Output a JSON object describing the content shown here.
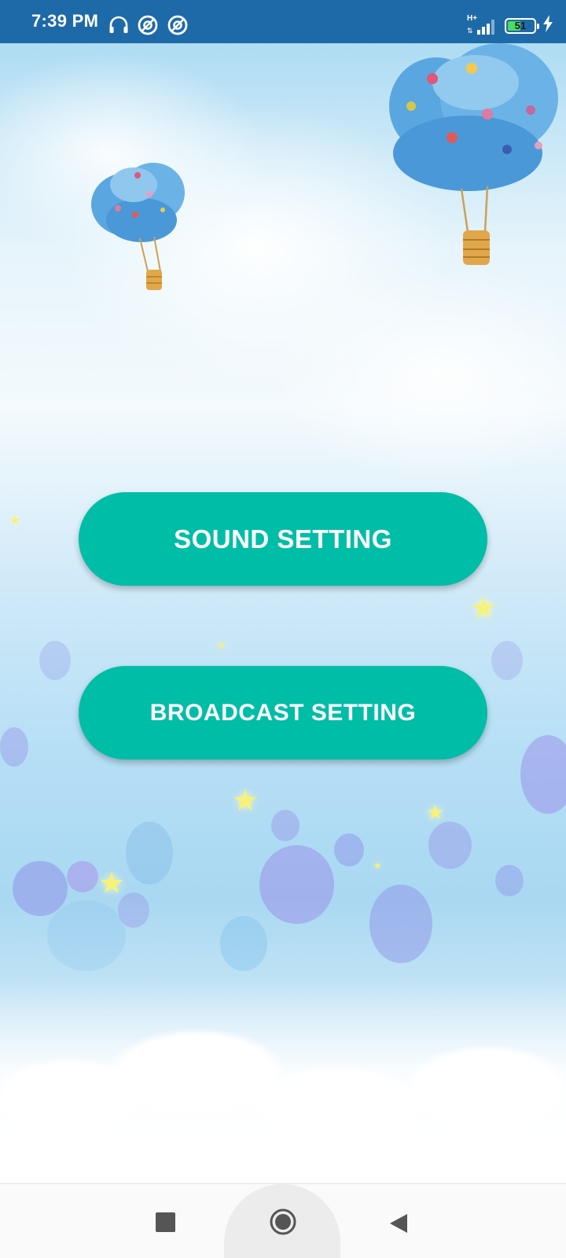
{
  "status_bar": {
    "time": "7:39 PM",
    "left_icons": [
      "headphones-icon",
      "app-notification-icon",
      "app-notification-icon"
    ],
    "network_type": "H+",
    "battery_level": "51",
    "battery_fraction": 0.51,
    "charging": true,
    "background_color": "#1e6aa9"
  },
  "main": {
    "sound_setting_label": "SOUND SETTING",
    "broadcast_setting_label": "BROADCAST SETTING",
    "button_color": "#00bda8"
  },
  "nav_bar": {
    "buttons": [
      "recents-button",
      "home-button",
      "back-button"
    ]
  }
}
